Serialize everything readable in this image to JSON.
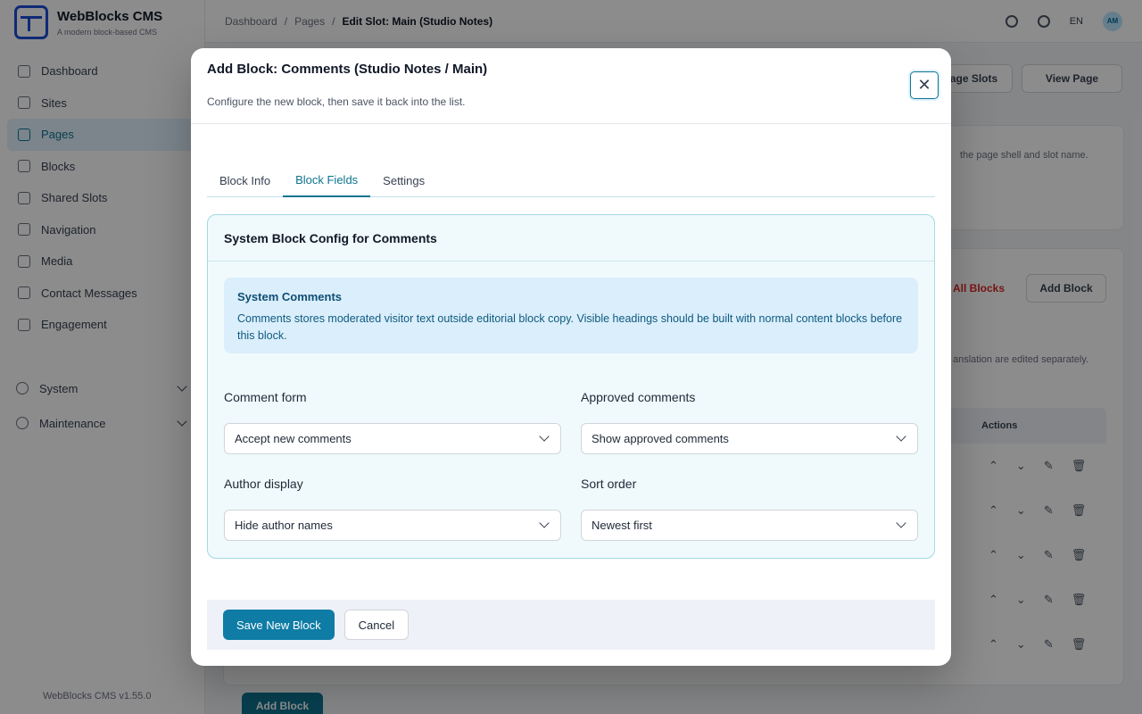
{
  "app": {
    "name": "WebBlocks CMS",
    "tagline": "A modern block-based CMS",
    "version": "WebBlocks CMS v1.55.0"
  },
  "sidebar": {
    "items": [
      {
        "label": "Dashboard",
        "icon": "grid-icon"
      },
      {
        "label": "Sites",
        "icon": "globe-icon"
      },
      {
        "label": "Pages",
        "icon": "file-icon",
        "active": true
      },
      {
        "label": "Blocks",
        "icon": "cube-icon"
      },
      {
        "label": "Shared Slots",
        "icon": "layers-icon"
      },
      {
        "label": "Navigation",
        "icon": "menu-icon"
      },
      {
        "label": "Media",
        "icon": "image-icon"
      },
      {
        "label": "Contact Messages",
        "icon": "mail-icon"
      },
      {
        "label": "Engagement",
        "icon": "star-icon"
      }
    ],
    "groups": [
      {
        "label": "System",
        "icon": "gear-icon"
      },
      {
        "label": "Maintenance",
        "icon": "wrench-icon"
      }
    ]
  },
  "topbar": {
    "breadcrumbs": [
      "Dashboard",
      "/",
      "Pages",
      "/",
      "Edit Slot: Main (Studio Notes)"
    ],
    "language": "EN",
    "avatar_initials": "AM"
  },
  "background": {
    "page_slots_label": "Page Slots",
    "view_page_label": "View Page",
    "shell_hint": "the page shell and slot name.",
    "delete_all_label": "All Blocks",
    "add_block_label": "Add Block",
    "translation_hint": "anslation are edited separately.",
    "actions_header": "Actions",
    "add_block_bottom": "Add Block"
  },
  "modal": {
    "title": "Add Block: Comments (Studio Notes / Main)",
    "subtitle": "Configure the new block, then save it back into the list.",
    "close_icon": "close-icon",
    "tabs": [
      {
        "label": "Block Info"
      },
      {
        "label": "Block Fields",
        "active": true
      },
      {
        "label": "Settings"
      }
    ],
    "config": {
      "heading": "System Block Config for Comments",
      "info_title": "System Comments",
      "info_text": "Comments stores moderated visitor text outside editorial block copy. Visible headings should be built with normal content blocks before this block.",
      "fields": [
        {
          "label": "Comment form",
          "value": "Accept new comments"
        },
        {
          "label": "Approved comments",
          "value": "Show approved comments"
        },
        {
          "label": "Author display",
          "value": "Hide author names"
        },
        {
          "label": "Sort order",
          "value": "Newest first"
        }
      ]
    },
    "footer": {
      "save_label": "Save New Block",
      "cancel_label": "Cancel"
    }
  },
  "colors": {
    "accent": "#0e7490",
    "primary_button": "#0e7ca5",
    "info_background": "#dbeefb"
  }
}
